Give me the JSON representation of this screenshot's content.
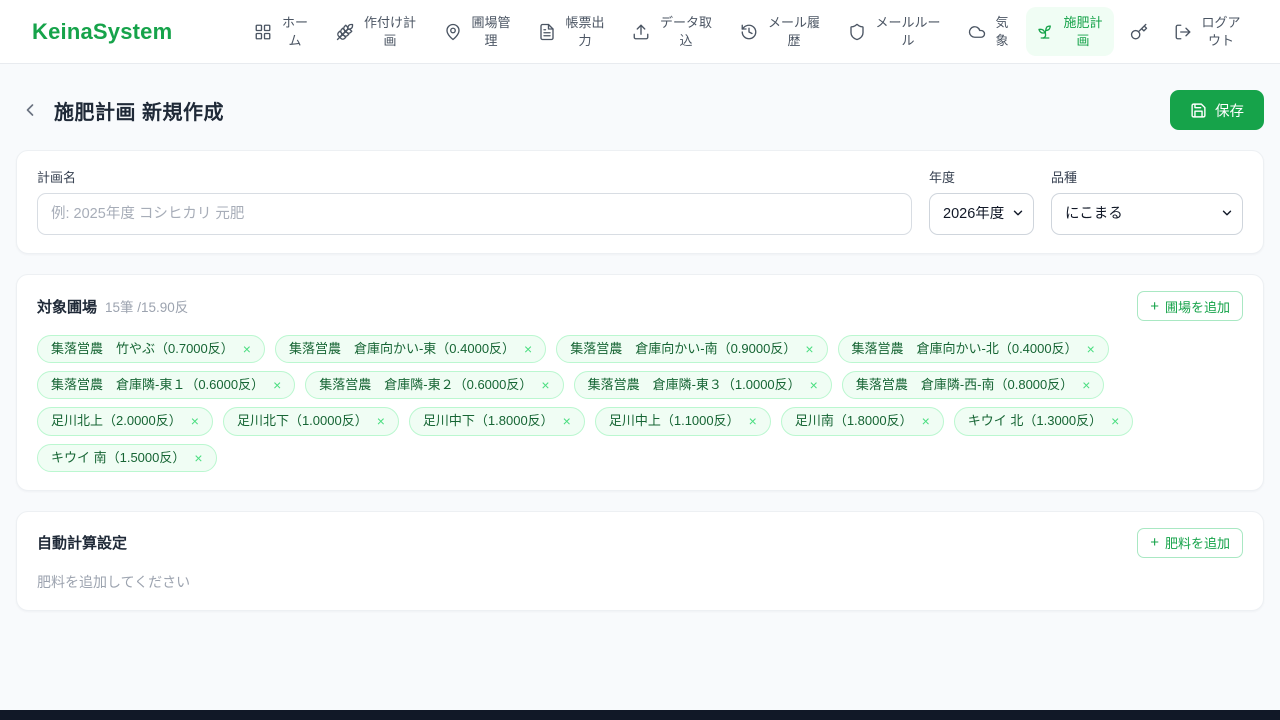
{
  "brand": "KeinaSystem",
  "nav": {
    "items": [
      {
        "label": "ホーム",
        "icon": "grid-icon",
        "active": false
      },
      {
        "label": "作付け計画",
        "icon": "wheat-icon",
        "active": false
      },
      {
        "label": "圃場管理",
        "icon": "map-pin-icon",
        "active": false
      },
      {
        "label": "帳票出力",
        "icon": "document-icon",
        "active": false
      },
      {
        "label": "データ取込",
        "icon": "upload-icon",
        "active": false
      },
      {
        "label": "メール履歴",
        "icon": "history-icon",
        "active": false
      },
      {
        "label": "メールルール",
        "icon": "shield-icon",
        "active": false
      },
      {
        "label": "気象",
        "icon": "cloud-icon",
        "active": false
      },
      {
        "label": "施肥計画",
        "icon": "sprout-icon",
        "active": true
      },
      {
        "label": "",
        "icon": "key-icon",
        "active": false
      },
      {
        "label": "ログアウト",
        "icon": "logout-icon",
        "active": false
      }
    ]
  },
  "header": {
    "title": "施肥計画 新規作成",
    "save_label": "保存"
  },
  "form": {
    "plan_name_label": "計画名",
    "plan_name_placeholder": "例: 2025年度 コシヒカリ 元肥",
    "year_label": "年度",
    "year_value": "2026年度",
    "variety_label": "品種",
    "variety_value": "にこまる"
  },
  "fields_section": {
    "title": "対象圃場",
    "summary": "15筆 /15.90反",
    "add_button_label": "圃場を追加",
    "chips": [
      "集落営農　竹やぶ（0.7000反）",
      "集落営農　倉庫向かい-東（0.4000反）",
      "集落営農　倉庫向かい-南（0.9000反）",
      "集落営農　倉庫向かい-北（0.4000反）",
      "集落営農　倉庫隣-東１（0.6000反）",
      "集落営農　倉庫隣-東２（0.6000反）",
      "集落営農　倉庫隣-東３（1.0000反）",
      "集落営農　倉庫隣-西-南（0.8000反）",
      "足川北上（2.0000反）",
      "足川北下（1.0000反）",
      "足川中下（1.8000反）",
      "足川中上（1.1000反）",
      "足川南（1.8000反）",
      "キウイ 北（1.3000反）",
      "キウイ 南（1.5000反）"
    ]
  },
  "auto_calc_section": {
    "title": "自動計算設定",
    "add_button_label": "肥料を追加",
    "empty_message": "肥料を追加してください"
  },
  "ui": {
    "plus_glyph": "+",
    "close_glyph": "×"
  },
  "colors": {
    "accent_green": "#16a34a",
    "active_nav_bg": "#f0fdf4",
    "chip_bg": "#f0fdf4",
    "chip_border": "#bbf7d0",
    "chip_text": "#166534",
    "page_bg": "#f8fafc"
  }
}
